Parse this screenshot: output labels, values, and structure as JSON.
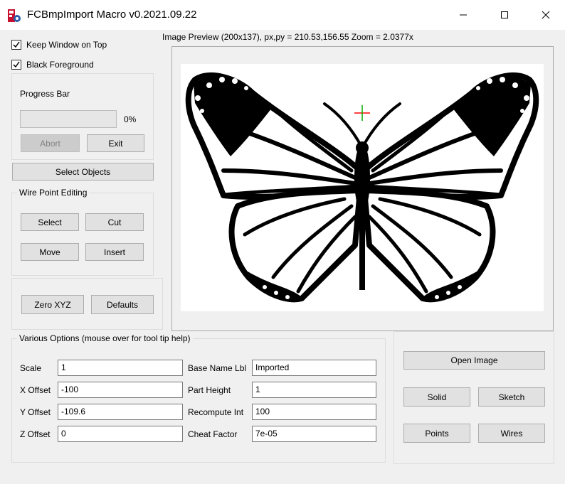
{
  "window": {
    "title": "FCBmpImport Macro v0.2021.09.22",
    "minimize_glyph": "—",
    "maximize_glyph": "☐",
    "close_glyph": "✕"
  },
  "options_top": {
    "keep_on_top_label": "Keep Window on Top",
    "keep_on_top_checked": true,
    "black_fg_label": "Black Foreground",
    "black_fg_checked": true
  },
  "progress": {
    "title": "Progress Bar",
    "value_percent": 0,
    "percent_text": "0%",
    "abort_label": "Abort",
    "exit_label": "Exit"
  },
  "select_objects_label": "Select Objects",
  "wire_editing": {
    "title": "Wire Point Editing",
    "select_label": "Select",
    "cut_label": "Cut",
    "move_label": "Move",
    "insert_label": "Insert"
  },
  "zero_xyz_label": "Zero XYZ",
  "defaults_label": "Defaults",
  "preview": {
    "label": "Image Preview (200x137),  px,py = 210.53,156.55  Zoom = 2.0377x"
  },
  "various": {
    "title": "Various Options (mouse over for tool tip help)",
    "scale_label": "Scale",
    "scale_value": "1",
    "x_offset_label": "X Offset",
    "x_offset_value": "-100",
    "y_offset_label": "Y Offset",
    "y_offset_value": "-109.6",
    "z_offset_label": "Z Offset",
    "z_offset_value": "0",
    "base_name_label": "Base Name Lbl",
    "base_name_value": "Imported",
    "part_height_label": "Part Height",
    "part_height_value": "1",
    "recompute_label": "Recompute Int",
    "recompute_value": "100",
    "cheat_label": "Cheat Factor",
    "cheat_value": "7e-05"
  },
  "actions": {
    "open_image_label": "Open Image",
    "solid_label": "Solid",
    "sketch_label": "Sketch",
    "points_label": "Points",
    "wires_label": "Wires"
  },
  "colors": {
    "accent_red": "#c8102e",
    "cursor_red": "#ff0000",
    "cursor_green": "#00b000"
  }
}
